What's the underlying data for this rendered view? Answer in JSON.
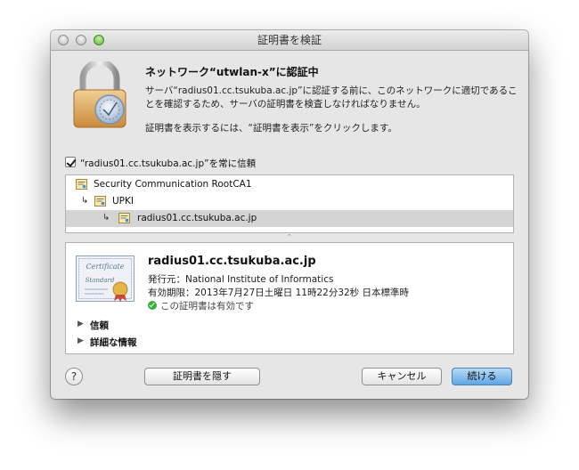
{
  "window": {
    "title": "証明書を検証"
  },
  "header": {
    "heading": "ネットワーク“utwlan-x”に認証中",
    "description": "サーバ“radius01.cc.tsukuba.ac.jp”に認証する前に、このネットワークに適切であることを確認するため、サーバの証明書を検査しなければなりません。",
    "instruction": "証明書を表示するには、“証明書を表示”をクリックします。"
  },
  "trust_checkbox": {
    "label": "“radius01.cc.tsukuba.ac.jp”を常に信頼",
    "checked": true
  },
  "tree": [
    {
      "label": "Security Communication RootCA1",
      "level": 0,
      "selected": false
    },
    {
      "label": "UPKI",
      "level": 1,
      "selected": false
    },
    {
      "label": "radius01.cc.tsukuba.ac.jp",
      "level": 2,
      "selected": true
    }
  ],
  "tree_arrow": "↳",
  "detail": {
    "image_text_1": "Certificate",
    "image_text_2": "Standard",
    "name": "radius01.cc.tsukuba.ac.jp",
    "issuer": "発行元：National Institute of Informatics",
    "expires": "有効期限：2013年7月27日土曜日 11時22分32秒 日本標準時",
    "status": "この証明書は有効です",
    "disclosures": [
      "信頼",
      "詳細な情報"
    ]
  },
  "buttons": {
    "help": "?",
    "hide_certificate": "証明書を隠す",
    "cancel": "キャンセル",
    "continue": "続ける"
  },
  "colors": {
    "accent": "#5fa6e4",
    "valid": "#35b13a",
    "selection": "#d4d4d4"
  }
}
